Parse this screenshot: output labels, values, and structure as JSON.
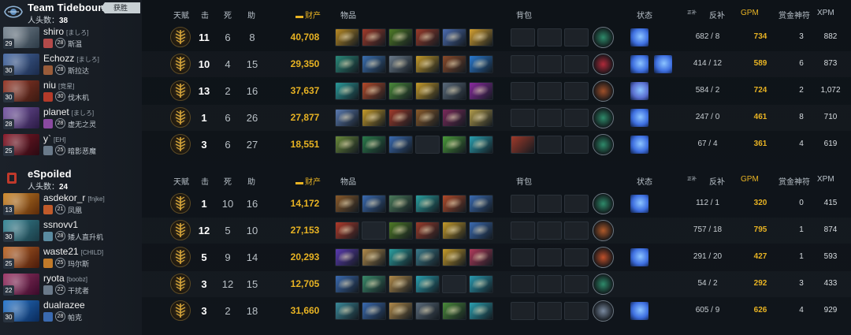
{
  "colors": {
    "gold": "#e8b323",
    "bg": "#0d1116",
    "dire_red": "#c0392b",
    "radiant_badge": "#c8d0d4"
  },
  "headers": {
    "talent": "天赋",
    "kills": "击",
    "deaths": "死",
    "assists": "助",
    "networth": "财产",
    "items": "物品",
    "backpack": "背包",
    "status": "状态",
    "lh_small": "正补",
    "denies": "反补",
    "gpm": "GPM",
    "runes": "赏金神符",
    "xpm": "XPM"
  },
  "teams": [
    {
      "name": "Team Tidebound",
      "badge": "获胜",
      "kills_label": "人头数：",
      "kills": "38",
      "logo_icon": "tidebound-logo-icon",
      "players": [
        {
          "name": "shiro",
          "tag": "[ましろ]",
          "level": "29",
          "rank_lvl": "28",
          "role": "斯温",
          "hero_colors": [
            "#7d8a96",
            "#2c3a46"
          ],
          "rank_color": "#b34a4a",
          "kills": "11",
          "deaths": "6",
          "assists": "8",
          "networth": "40,708",
          "items": [
            "#b88a24",
            "#a03a2a",
            "#4e7a25",
            "#9a3b2a",
            "#4b6cb0",
            "#d4a030"
          ],
          "backpack": [
            0,
            0,
            0
          ],
          "neutral": "#2e8a6a",
          "buffs": [
            "#3e6fe0"
          ],
          "lh": "682",
          "dn": "8",
          "gpm": "734",
          "runes": "3",
          "xpm": "882"
        },
        {
          "name": "Echozz",
          "tag": "[ましろ]",
          "level": "30",
          "rank_lvl": "28",
          "role": "斯拉达",
          "hero_colors": [
            "#4a6da8",
            "#1b2b4a"
          ],
          "rank_color": "#9a5c3a",
          "kills": "10",
          "deaths": "4",
          "assists": "15",
          "networth": "29,350",
          "items": [
            "#2a8a7a",
            "#3a6fb0",
            "#6a7a8a",
            "#c49a2a",
            "#8a4a2a",
            "#2a7ad0"
          ],
          "backpack": [
            0,
            0,
            0
          ],
          "neutral": "#b02a3a",
          "buffs": [
            "#3e6fe0",
            "#3e6fe0"
          ],
          "lh": "414",
          "dn": "12",
          "gpm": "589",
          "runes": "6",
          "xpm": "873"
        },
        {
          "name": "niu",
          "tag": "[竞星]",
          "level": "30",
          "rank_lvl": "30",
          "role": "伐木机",
          "hero_colors": [
            "#9a3a2a",
            "#3a1a12"
          ],
          "rank_color": "#b33a2a",
          "kills": "13",
          "deaths": "2",
          "assists": "16",
          "networth": "37,637",
          "items": [
            "#2a9a9a",
            "#b34a2a",
            "#4a8a3a",
            "#c49a2a",
            "#5a6a7a",
            "#8a2aa0"
          ],
          "backpack": [
            0,
            0,
            0
          ],
          "neutral": "#a0502a",
          "buffs": [
            "#5a6fd0"
          ],
          "lh": "584",
          "dn": "2",
          "gpm": "724",
          "runes": "2",
          "xpm": "1,072"
        },
        {
          "name": "planet",
          "tag": "[ましろ]",
          "level": "28",
          "rank_lvl": "28",
          "role": "虚无之灵",
          "hero_colors": [
            "#7a5aa8",
            "#2a1a44"
          ],
          "rank_color": "#8a4aa0",
          "kills": "1",
          "deaths": "6",
          "assists": "26",
          "networth": "27,877",
          "items": [
            "#5a7ab0",
            "#c49a2a",
            "#a03a2a",
            "#8a5a2a",
            "#7a2a5a",
            "#b09a4a"
          ],
          "backpack": [
            0,
            0,
            0
          ],
          "neutral": "#2e8a6a",
          "buffs": [
            "#3e6fe0"
          ],
          "lh": "247",
          "dn": "0",
          "gpm": "461",
          "runes": "8",
          "xpm": "710"
        },
        {
          "name": "y`",
          "tag": "[EH]",
          "level": "25",
          "rank_lvl": "25",
          "role": "暗影恶魔",
          "hero_colors": [
            "#8a1a2a",
            "#2a0a12"
          ],
          "rank_color": "#6a7a8a",
          "kills": "3",
          "deaths": "6",
          "assists": "27",
          "networth": "18,551",
          "items": [
            "#6a8a3a",
            "#2a7a4a",
            "#3a6ab0",
            null,
            "#4a9a3a",
            "#2aa0b0"
          ],
          "backpack": [
            1,
            0,
            0
          ],
          "neutral": "#2e8a6a",
          "buffs": [
            "#3e6fe0"
          ],
          "lh": "67",
          "dn": "4",
          "gpm": "361",
          "runes": "4",
          "xpm": "619"
        }
      ]
    },
    {
      "name": "eSpoiled",
      "badge": "",
      "kills_label": "人头数：",
      "kills": "24",
      "logo_icon": "espoiled-logo-icon",
      "players": [
        {
          "name": "asdekor_r",
          "tag": "[fnjke]",
          "level": "13",
          "rank_lvl": "21",
          "role": "凤凰",
          "hero_colors": [
            "#d08a2a",
            "#5a2a0a"
          ],
          "rank_color": "#c05a2a",
          "kills": "1",
          "deaths": "10",
          "assists": "16",
          "networth": "14,172",
          "items": [
            "#8a5a2a",
            "#3a6ab0",
            "#4a7a5a",
            "#2aa0a0",
            "#b04a2a",
            "#3a6ab0"
          ],
          "backpack": [
            0,
            0,
            0
          ],
          "neutral": "#2e8a6a",
          "buffs": [
            "#3e6fe0"
          ],
          "lh": "112",
          "dn": "1",
          "gpm": "320",
          "runes": "0",
          "xpm": "415"
        },
        {
          "name": "ssnovv1",
          "tag": "",
          "level": "30",
          "rank_lvl": "28",
          "role": "矮人直升机",
          "hero_colors": [
            "#3a8a9a",
            "#1a3a44"
          ],
          "rank_color": "#5a8aa0",
          "kills": "12",
          "deaths": "5",
          "assists": "10",
          "networth": "27,153",
          "items": [
            "#b03a2a",
            null,
            "#4e7a25",
            "#9a3b2a",
            "#c49a2a",
            "#3a6ab0"
          ],
          "backpack": [
            0,
            0,
            0
          ],
          "neutral": "#b05a2a",
          "buffs": [],
          "lh": "757",
          "dn": "18",
          "gpm": "795",
          "runes": "1",
          "xpm": "874"
        },
        {
          "name": "waste21",
          "tag": "[CHILD]",
          "level": "25",
          "rank_lvl": "25",
          "role": "玛尔斯",
          "hero_colors": [
            "#c06a2a",
            "#4a1a0a"
          ],
          "rank_color": "#c07a2a",
          "kills": "5",
          "deaths": "9",
          "assists": "14",
          "networth": "20,293",
          "items": [
            "#5a3ab0",
            "#b08a4a",
            "#2aa0a0",
            "#3a7a8a",
            "#c49a2a",
            "#b03a5a"
          ],
          "backpack": [
            0,
            0,
            0
          ],
          "neutral": "#c0502a",
          "buffs": [
            "#3e6fe0"
          ],
          "lh": "291",
          "dn": "20",
          "gpm": "427",
          "runes": "1",
          "xpm": "593"
        },
        {
          "name": "ryota",
          "tag": "[boobz]",
          "level": "22",
          "rank_lvl": "22",
          "role": "干扰者",
          "hero_colors": [
            "#a03a6a",
            "#3a0a2a"
          ],
          "rank_color": "#6a7a8a",
          "kills": "3",
          "deaths": "12",
          "assists": "15",
          "networth": "12,705",
          "items": [
            "#3a6ab0",
            "#3a8a6a",
            "#b08a4a",
            "#2aa0b0",
            null,
            "#2a9ab0"
          ],
          "backpack": [
            0,
            0,
            0
          ],
          "neutral": "#2e8a6a",
          "buffs": [],
          "lh": "54",
          "dn": "2",
          "gpm": "292",
          "runes": "3",
          "xpm": "433"
        },
        {
          "name": "dualrazee",
          "tag": "",
          "level": "30",
          "rank_lvl": "28",
          "role": "帕克",
          "hero_colors": [
            "#2a7ad0",
            "#0a2a5a"
          ],
          "rank_color": "#3a6ab0",
          "kills": "3",
          "deaths": "2",
          "assists": "18",
          "networth": "31,660",
          "items": [
            "#3a8a9a",
            "#3a6ab0",
            "#b08a4a",
            "#5a6a7a",
            "#4a8a3a",
            "#2aa0b0"
          ],
          "backpack": [
            0,
            0,
            0
          ],
          "neutral": "#7a8aa0",
          "buffs": [
            "#3e6fe0"
          ],
          "lh": "605",
          "dn": "9",
          "gpm": "626",
          "runes": "4",
          "xpm": "929"
        }
      ]
    }
  ]
}
